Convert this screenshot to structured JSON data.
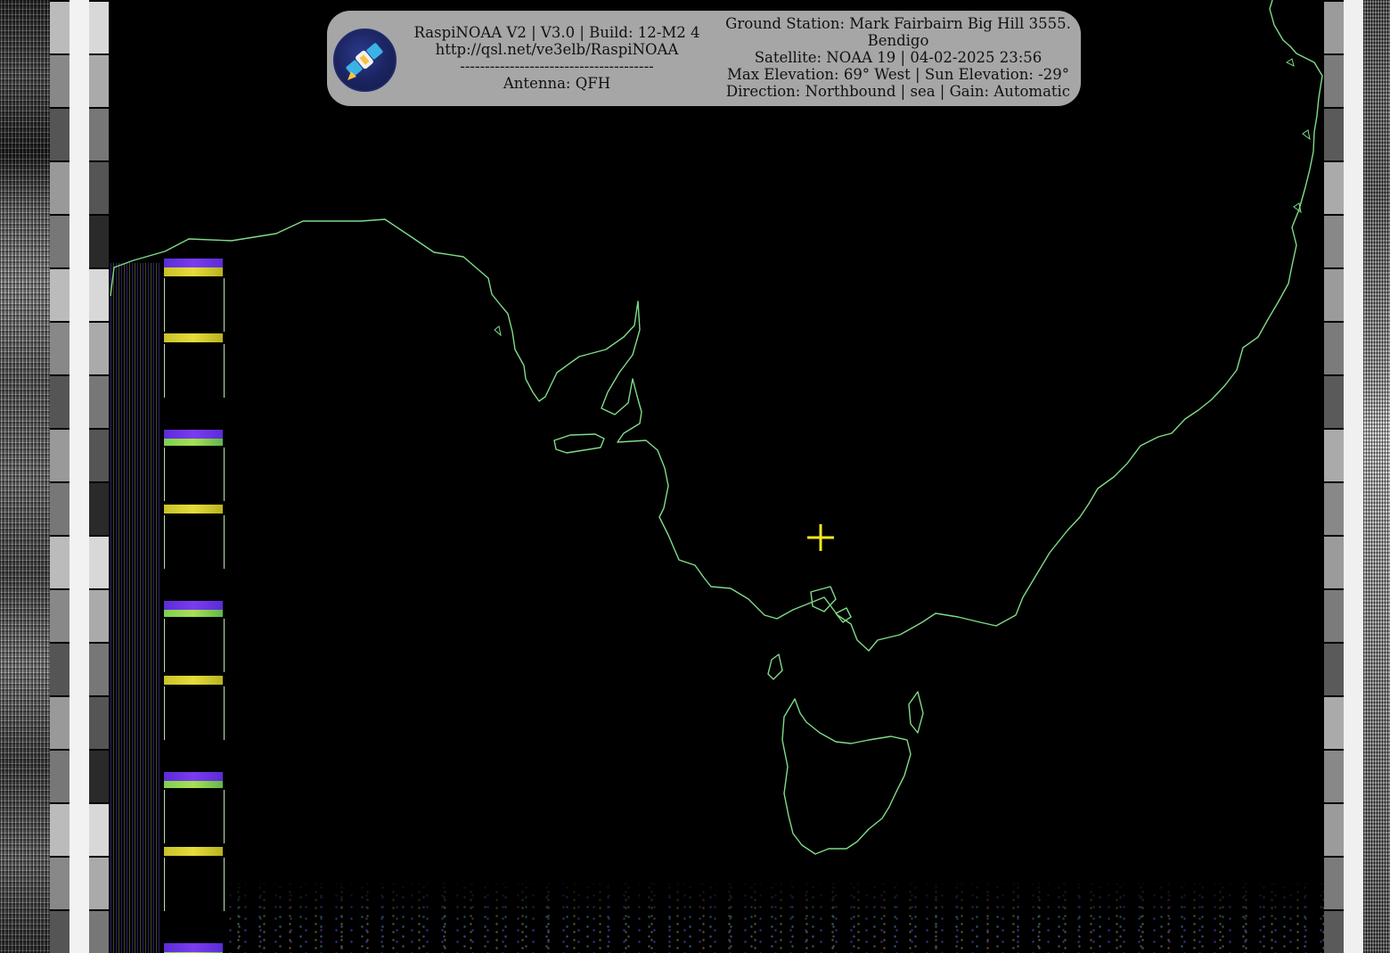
{
  "header": {
    "left_lines": [
      "RaspiNOAA V2 | V3.0 | Build: 12-M2 4",
      "http://qsl.net/ve3elb/RaspiNOAA",
      "---------------------------------------",
      "Antenna: QFH"
    ],
    "right_lines": [
      "Ground Station: Mark Fairbairn Big Hill 3555.",
      "Bendigo",
      "Satellite: NOAA 19 | 04-02-2025 23:56",
      "Max Elevation: 69° West | Sun Elevation: -29°",
      "Direction: Northbound | sea | Gain: Automatic"
    ]
  },
  "colors": {
    "coastline": "#7fdc88",
    "marker": "#f5e61e",
    "info_box": "#a6a6a6",
    "background": "#000000"
  },
  "icons": {
    "logo": "satellite-logo-icon",
    "marker": "crosshair-marker-icon"
  }
}
